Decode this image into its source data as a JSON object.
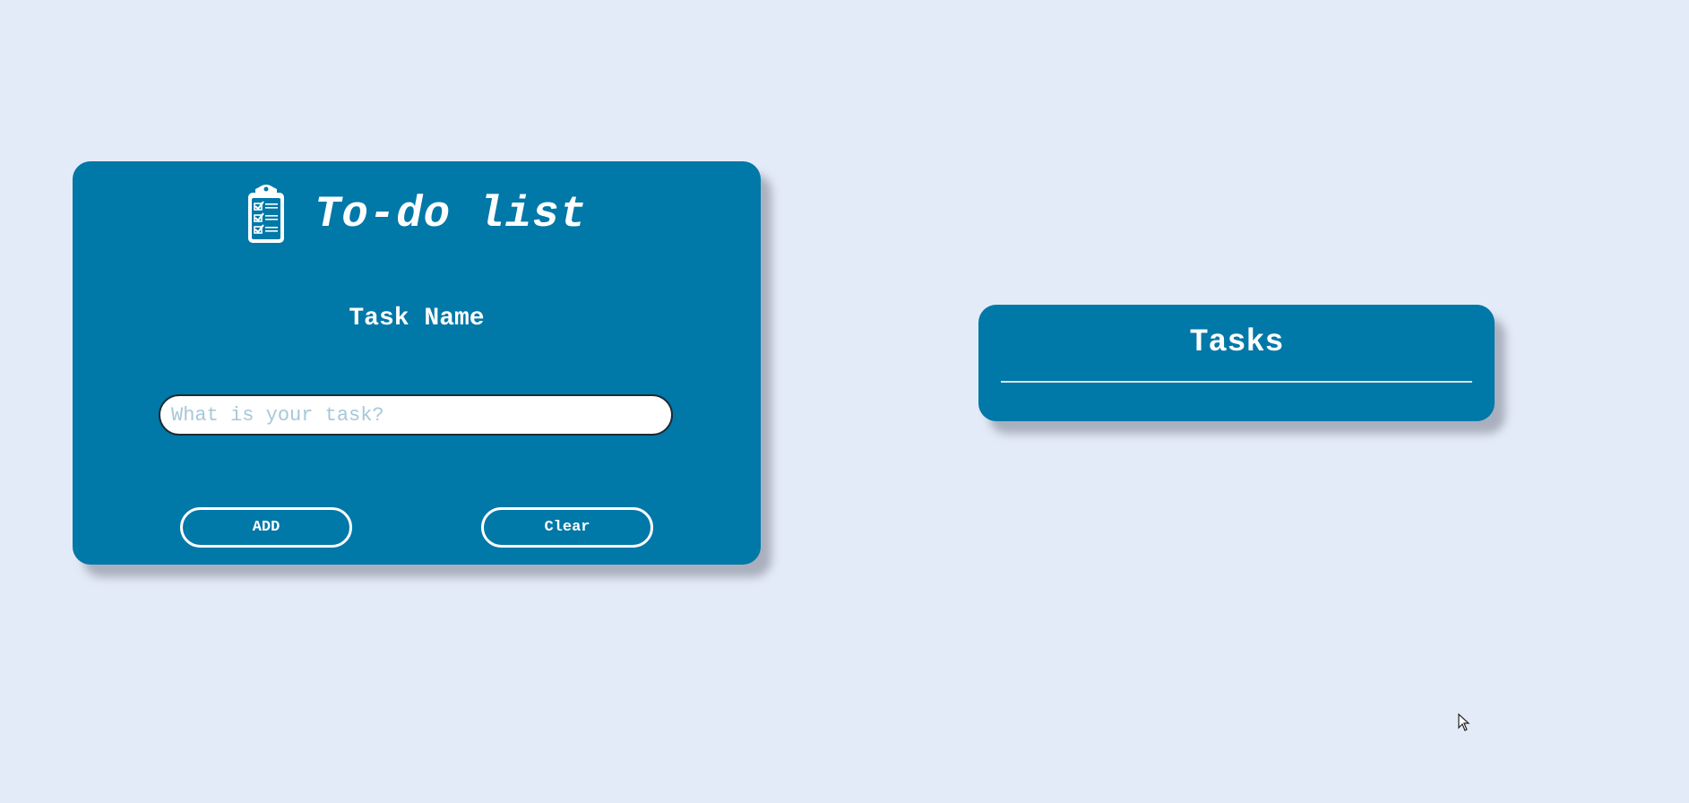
{
  "app": {
    "title": "To-do list",
    "icon": "clipboard-checklist-icon"
  },
  "form": {
    "label": "Task Name",
    "input": {
      "value": "",
      "placeholder": "What is your task?"
    },
    "add_label": "ADD",
    "clear_label": "Clear"
  },
  "tasks": {
    "title": "Tasks",
    "items": []
  },
  "colors": {
    "background": "#e4ebf8",
    "card": "#0078a8",
    "text": "#ffffff",
    "placeholder": "#a6c8d8"
  }
}
